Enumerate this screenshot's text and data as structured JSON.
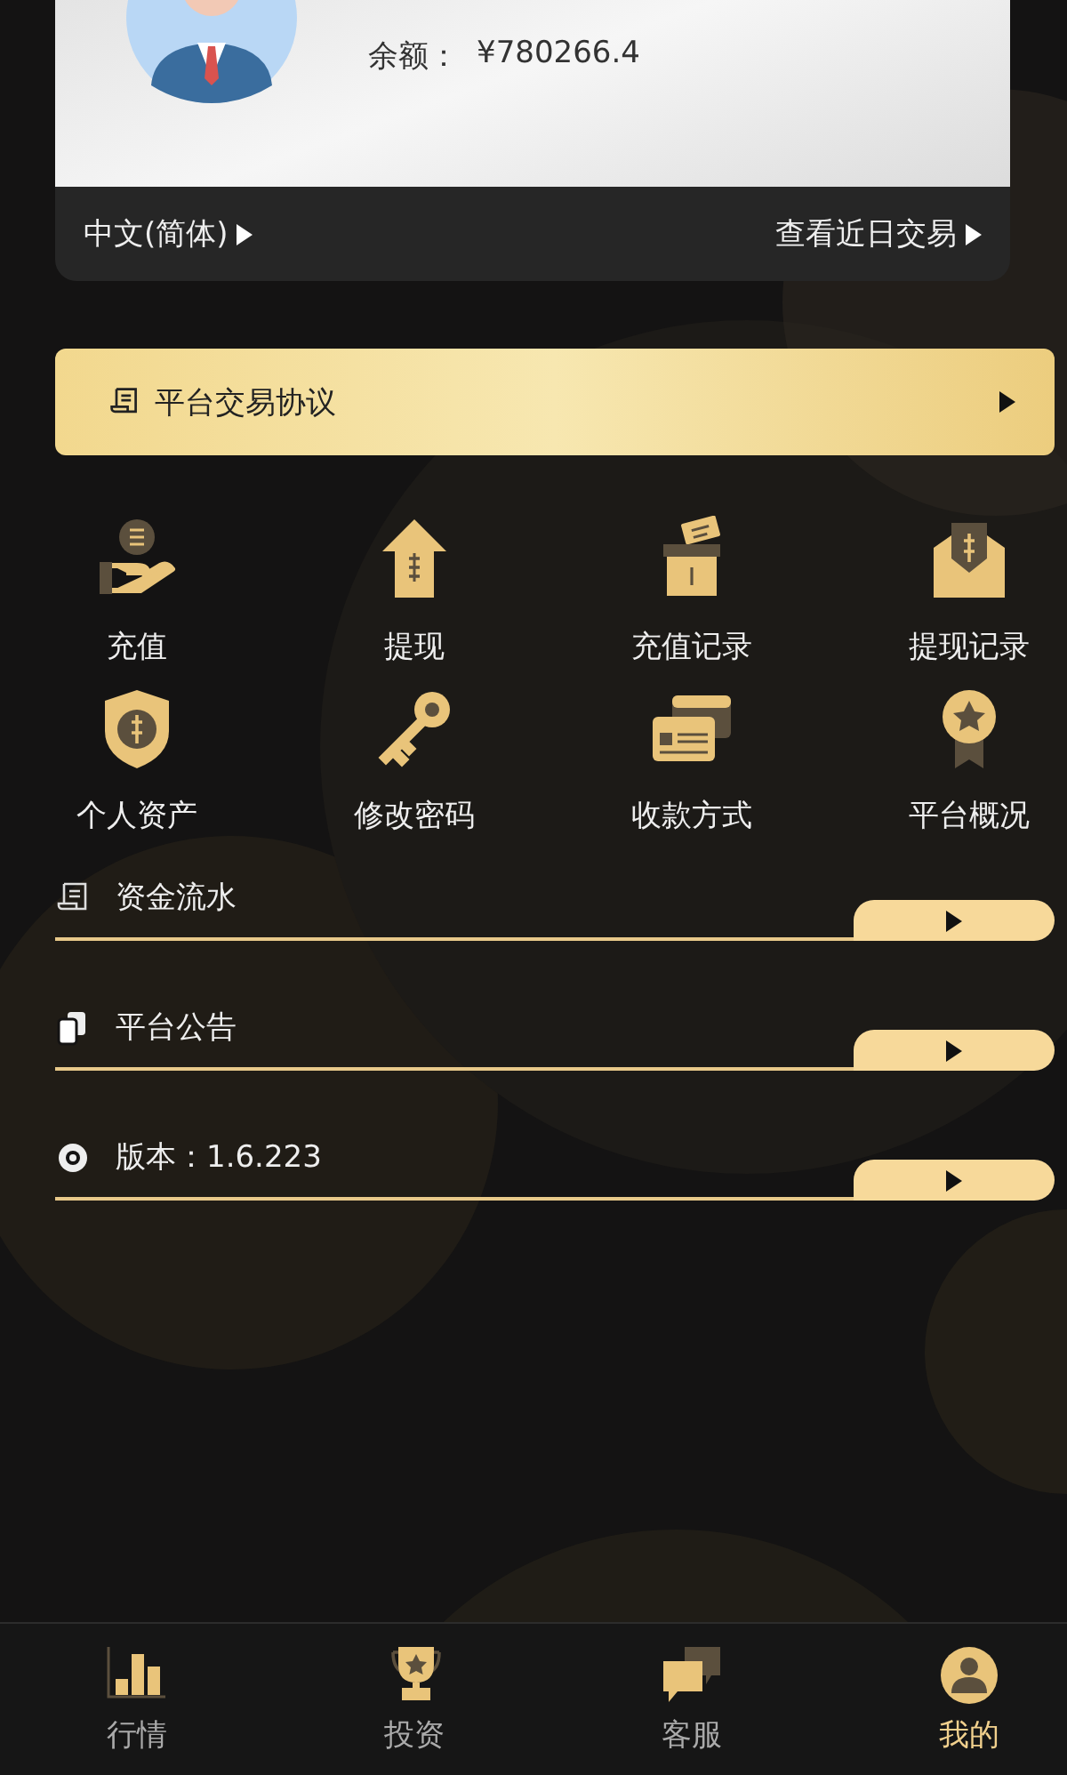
{
  "account": {
    "balance_label": "余额：",
    "balance": "¥780266.4",
    "language": "中文(简体)",
    "recent_link": "查看近日交易"
  },
  "agreement": {
    "label": "平台交易协议"
  },
  "shortcuts": [
    {
      "label": "充值",
      "kind": "deposit"
    },
    {
      "label": "提现",
      "kind": "withdraw"
    },
    {
      "label": "充值记录",
      "kind": "deposit-record"
    },
    {
      "label": "提现记录",
      "kind": "withdraw-record"
    },
    {
      "label": "个人资产",
      "kind": "assets"
    },
    {
      "label": "修改密码",
      "kind": "password"
    },
    {
      "label": "收款方式",
      "kind": "payment"
    },
    {
      "label": "平台概况",
      "kind": "overview"
    }
  ],
  "menu": [
    {
      "label": "资金流水",
      "kind": "ledger"
    },
    {
      "label": "平台公告",
      "kind": "notice"
    },
    {
      "label": "版本：1.6.223",
      "kind": "version"
    }
  ],
  "tabs": [
    {
      "label": "行情",
      "kind": "market",
      "selected": false
    },
    {
      "label": "投资",
      "kind": "invest",
      "selected": false
    },
    {
      "label": "客服",
      "kind": "service",
      "selected": false
    },
    {
      "label": "我的",
      "kind": "mine",
      "selected": true
    }
  ]
}
